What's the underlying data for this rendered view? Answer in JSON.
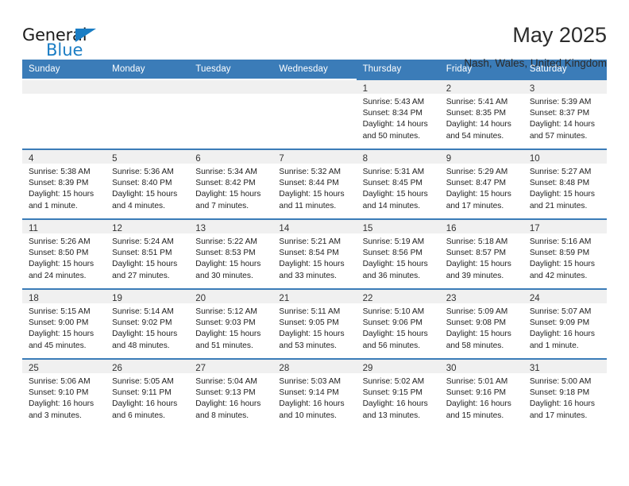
{
  "brand": {
    "name_top": "General",
    "name_bottom": "Blue",
    "accent_color": "#1a7dc4"
  },
  "header": {
    "title": "May 2025",
    "location": "Nash, Wales, United Kingdom"
  },
  "calendar": {
    "header_bg": "#3b7cb8",
    "weekdays": [
      "Sunday",
      "Monday",
      "Tuesday",
      "Wednesday",
      "Thursday",
      "Friday",
      "Saturday"
    ],
    "weeks": [
      [
        {
          "empty": true
        },
        {
          "empty": true
        },
        {
          "empty": true
        },
        {
          "empty": true
        },
        {
          "day": "1",
          "sunrise": "Sunrise: 5:43 AM",
          "sunset": "Sunset: 8:34 PM",
          "daylight1": "Daylight: 14 hours",
          "daylight2": "and 50 minutes."
        },
        {
          "day": "2",
          "sunrise": "Sunrise: 5:41 AM",
          "sunset": "Sunset: 8:35 PM",
          "daylight1": "Daylight: 14 hours",
          "daylight2": "and 54 minutes."
        },
        {
          "day": "3",
          "sunrise": "Sunrise: 5:39 AM",
          "sunset": "Sunset: 8:37 PM",
          "daylight1": "Daylight: 14 hours",
          "daylight2": "and 57 minutes."
        }
      ],
      [
        {
          "day": "4",
          "sunrise": "Sunrise: 5:38 AM",
          "sunset": "Sunset: 8:39 PM",
          "daylight1": "Daylight: 15 hours",
          "daylight2": "and 1 minute."
        },
        {
          "day": "5",
          "sunrise": "Sunrise: 5:36 AM",
          "sunset": "Sunset: 8:40 PM",
          "daylight1": "Daylight: 15 hours",
          "daylight2": "and 4 minutes."
        },
        {
          "day": "6",
          "sunrise": "Sunrise: 5:34 AM",
          "sunset": "Sunset: 8:42 PM",
          "daylight1": "Daylight: 15 hours",
          "daylight2": "and 7 minutes."
        },
        {
          "day": "7",
          "sunrise": "Sunrise: 5:32 AM",
          "sunset": "Sunset: 8:44 PM",
          "daylight1": "Daylight: 15 hours",
          "daylight2": "and 11 minutes."
        },
        {
          "day": "8",
          "sunrise": "Sunrise: 5:31 AM",
          "sunset": "Sunset: 8:45 PM",
          "daylight1": "Daylight: 15 hours",
          "daylight2": "and 14 minutes."
        },
        {
          "day": "9",
          "sunrise": "Sunrise: 5:29 AM",
          "sunset": "Sunset: 8:47 PM",
          "daylight1": "Daylight: 15 hours",
          "daylight2": "and 17 minutes."
        },
        {
          "day": "10",
          "sunrise": "Sunrise: 5:27 AM",
          "sunset": "Sunset: 8:48 PM",
          "daylight1": "Daylight: 15 hours",
          "daylight2": "and 21 minutes."
        }
      ],
      [
        {
          "day": "11",
          "sunrise": "Sunrise: 5:26 AM",
          "sunset": "Sunset: 8:50 PM",
          "daylight1": "Daylight: 15 hours",
          "daylight2": "and 24 minutes."
        },
        {
          "day": "12",
          "sunrise": "Sunrise: 5:24 AM",
          "sunset": "Sunset: 8:51 PM",
          "daylight1": "Daylight: 15 hours",
          "daylight2": "and 27 minutes."
        },
        {
          "day": "13",
          "sunrise": "Sunrise: 5:22 AM",
          "sunset": "Sunset: 8:53 PM",
          "daylight1": "Daylight: 15 hours",
          "daylight2": "and 30 minutes."
        },
        {
          "day": "14",
          "sunrise": "Sunrise: 5:21 AM",
          "sunset": "Sunset: 8:54 PM",
          "daylight1": "Daylight: 15 hours",
          "daylight2": "and 33 minutes."
        },
        {
          "day": "15",
          "sunrise": "Sunrise: 5:19 AM",
          "sunset": "Sunset: 8:56 PM",
          "daylight1": "Daylight: 15 hours",
          "daylight2": "and 36 minutes."
        },
        {
          "day": "16",
          "sunrise": "Sunrise: 5:18 AM",
          "sunset": "Sunset: 8:57 PM",
          "daylight1": "Daylight: 15 hours",
          "daylight2": "and 39 minutes."
        },
        {
          "day": "17",
          "sunrise": "Sunrise: 5:16 AM",
          "sunset": "Sunset: 8:59 PM",
          "daylight1": "Daylight: 15 hours",
          "daylight2": "and 42 minutes."
        }
      ],
      [
        {
          "day": "18",
          "sunrise": "Sunrise: 5:15 AM",
          "sunset": "Sunset: 9:00 PM",
          "daylight1": "Daylight: 15 hours",
          "daylight2": "and 45 minutes."
        },
        {
          "day": "19",
          "sunrise": "Sunrise: 5:14 AM",
          "sunset": "Sunset: 9:02 PM",
          "daylight1": "Daylight: 15 hours",
          "daylight2": "and 48 minutes."
        },
        {
          "day": "20",
          "sunrise": "Sunrise: 5:12 AM",
          "sunset": "Sunset: 9:03 PM",
          "daylight1": "Daylight: 15 hours",
          "daylight2": "and 51 minutes."
        },
        {
          "day": "21",
          "sunrise": "Sunrise: 5:11 AM",
          "sunset": "Sunset: 9:05 PM",
          "daylight1": "Daylight: 15 hours",
          "daylight2": "and 53 minutes."
        },
        {
          "day": "22",
          "sunrise": "Sunrise: 5:10 AM",
          "sunset": "Sunset: 9:06 PM",
          "daylight1": "Daylight: 15 hours",
          "daylight2": "and 56 minutes."
        },
        {
          "day": "23",
          "sunrise": "Sunrise: 5:09 AM",
          "sunset": "Sunset: 9:08 PM",
          "daylight1": "Daylight: 15 hours",
          "daylight2": "and 58 minutes."
        },
        {
          "day": "24",
          "sunrise": "Sunrise: 5:07 AM",
          "sunset": "Sunset: 9:09 PM",
          "daylight1": "Daylight: 16 hours",
          "daylight2": "and 1 minute."
        }
      ],
      [
        {
          "day": "25",
          "sunrise": "Sunrise: 5:06 AM",
          "sunset": "Sunset: 9:10 PM",
          "daylight1": "Daylight: 16 hours",
          "daylight2": "and 3 minutes."
        },
        {
          "day": "26",
          "sunrise": "Sunrise: 5:05 AM",
          "sunset": "Sunset: 9:11 PM",
          "daylight1": "Daylight: 16 hours",
          "daylight2": "and 6 minutes."
        },
        {
          "day": "27",
          "sunrise": "Sunrise: 5:04 AM",
          "sunset": "Sunset: 9:13 PM",
          "daylight1": "Daylight: 16 hours",
          "daylight2": "and 8 minutes."
        },
        {
          "day": "28",
          "sunrise": "Sunrise: 5:03 AM",
          "sunset": "Sunset: 9:14 PM",
          "daylight1": "Daylight: 16 hours",
          "daylight2": "and 10 minutes."
        },
        {
          "day": "29",
          "sunrise": "Sunrise: 5:02 AM",
          "sunset": "Sunset: 9:15 PM",
          "daylight1": "Daylight: 16 hours",
          "daylight2": "and 13 minutes."
        },
        {
          "day": "30",
          "sunrise": "Sunrise: 5:01 AM",
          "sunset": "Sunset: 9:16 PM",
          "daylight1": "Daylight: 16 hours",
          "daylight2": "and 15 minutes."
        },
        {
          "day": "31",
          "sunrise": "Sunrise: 5:00 AM",
          "sunset": "Sunset: 9:18 PM",
          "daylight1": "Daylight: 16 hours",
          "daylight2": "and 17 minutes."
        }
      ]
    ]
  }
}
